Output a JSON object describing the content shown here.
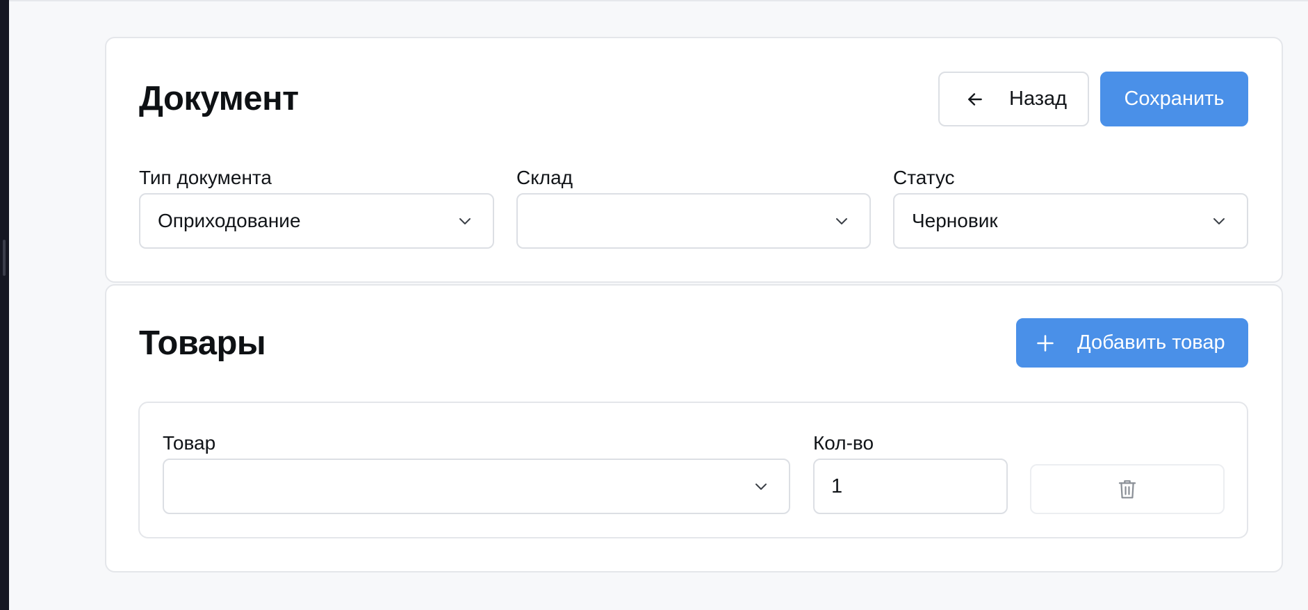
{
  "document_section": {
    "title": "Документ",
    "back_label": "Назад",
    "back_icon": "arrow-left-icon",
    "save_label": "Сохранить",
    "fields": {
      "doc_type": {
        "label": "Тип документа",
        "value": "Оприходование"
      },
      "warehouse": {
        "label": "Склад",
        "value": ""
      },
      "status": {
        "label": "Статус",
        "value": "Черновик"
      }
    }
  },
  "items_section": {
    "title": "Товары",
    "add_label": "Добавить товар",
    "add_icon": "plus-icon",
    "row": {
      "product_label": "Товар",
      "product_value": "",
      "qty_label": "Кол-во",
      "qty_value": "1",
      "delete_icon": "trash-icon"
    }
  },
  "colors": {
    "primary": "#4a90e8",
    "page_background": "#f7f8fa",
    "card_background": "#ffffff",
    "border": "#dcdfe4"
  }
}
